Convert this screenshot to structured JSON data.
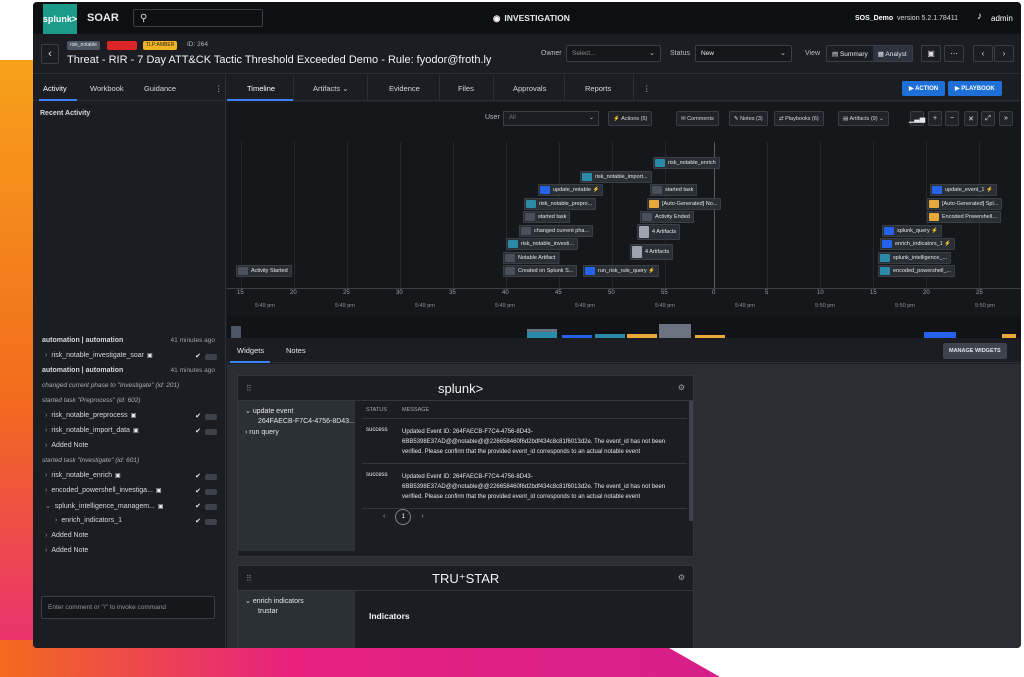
{
  "app": {
    "logo": "splunk>",
    "name": "SOAR",
    "center_title": "INVESTIGATION",
    "tenant": "SOS_Demo",
    "version": "version 5.2.1.78411",
    "user": "admin"
  },
  "case": {
    "tags": [
      "risk_notable",
      "",
      "TLP:AMBER"
    ],
    "id_label": "ID: 264",
    "title": "Threat - RIR - 7 Day ATT&CK Tactic Threshold Exceeded Demo - Rule: fyodor@froth.ly",
    "owner_label": "Owner",
    "owner_placeholder": "Select...",
    "status_label": "Status",
    "status_value": "New",
    "view_label": "View",
    "view_summary": "Summary",
    "view_analyst": "Analyst"
  },
  "left": {
    "tabs": [
      "Activity",
      "Workbook",
      "Guidance"
    ],
    "recent_title": "Recent Activity",
    "feed": [
      {
        "kind": "head",
        "text": "automation | automation",
        "time": "41 minutes ago"
      },
      {
        "kind": "item",
        "text": "risk_notable_investigate_soar"
      },
      {
        "kind": "head",
        "text": "automation | automation",
        "time": "41 minutes ago"
      },
      {
        "kind": "note",
        "text": "changed current phase to \"Investigate\" (id: 201)"
      },
      {
        "kind": "note",
        "text": "started task \"Preprocess\" (id: 602)"
      },
      {
        "kind": "item",
        "text": "risk_notable_preprocess"
      },
      {
        "kind": "item",
        "text": "risk_notable_import_data"
      },
      {
        "kind": "plain",
        "text": "Added Note"
      },
      {
        "kind": "note",
        "text": "started task \"Investigate\" (id: 601)"
      },
      {
        "kind": "item",
        "text": "risk_notable_enrich"
      },
      {
        "kind": "item",
        "text": "encoded_powershell_investiga..."
      },
      {
        "kind": "item",
        "text": "splunk_intelligence_managem..."
      },
      {
        "kind": "sub",
        "text": "enrich_indicators_1"
      },
      {
        "kind": "plain",
        "text": "Added Note"
      },
      {
        "kind": "plain",
        "text": "Added Note"
      }
    ],
    "comment_placeholder": "Enter comment or \"/\" to invoke command"
  },
  "main": {
    "tabs": [
      "Timeline",
      "Artifacts",
      "Evidence",
      "Files",
      "Approvals",
      "Reports"
    ],
    "action_btn": "ACTION",
    "playbook_btn": "PLAYBOOK",
    "user_label": "User",
    "user_value": "All",
    "filters": [
      "Actions (5)",
      "Comments",
      "Notes (3)",
      "Playbooks (6)",
      "Artifacts (9)"
    ],
    "events": [
      {
        "text": "risk_notable_enrich"
      },
      {
        "text": "risk_notable_import..."
      },
      {
        "text": "update_notable"
      },
      {
        "text": "started task"
      },
      {
        "text": "risk_notable_prepro..."
      },
      {
        "text": "[Auto-Generated] No..."
      },
      {
        "text": "started task"
      },
      {
        "text": "Activity Ended"
      },
      {
        "text": "changed current pha..."
      },
      {
        "text": "4 Artifacts"
      },
      {
        "text": "risk_notable_investi..."
      },
      {
        "text": "4 Artifacts"
      },
      {
        "text": "Notable Artifact"
      },
      {
        "text": "Created on Splunk S..."
      },
      {
        "text": "run_risk_rule_query"
      },
      {
        "text": "Activity Started"
      },
      {
        "text": "update_event_1"
      },
      {
        "text": "[Auto-Generated] Spl..."
      },
      {
        "text": "Encoded Powershell..."
      },
      {
        "text": "splunk_query"
      },
      {
        "text": "enrich_indicators_1"
      },
      {
        "text": "splunk_intelligence_..."
      },
      {
        "text": "encoded_powershell_..."
      }
    ],
    "ticks": [
      "15",
      "20",
      "25",
      "30",
      "35",
      "40",
      "45",
      "50",
      "55",
      "0",
      "5",
      "10",
      "15",
      "20",
      "25"
    ],
    "tick_times": [
      "5:49 pm",
      "5:49 pm",
      "5:49 pm",
      "5:49 pm",
      "5:49 pm",
      "5:49 pm",
      "5:49 pm",
      "5:50 pm",
      "5:50 pm",
      "5:50 pm"
    ],
    "widget_tabs": [
      "Widgets",
      "Notes"
    ],
    "manage_btn": "MANAGE WIDGETS"
  },
  "widget1": {
    "logo": "splunk>",
    "tree": [
      "update event",
      "264FAECB-F7C4-4756-8D43...",
      "run query"
    ],
    "col_status": "STATUS",
    "col_message": "MESSAGE",
    "rows": [
      {
        "status": "success",
        "message": "Updated Event ID: 264FAECB-F7C4-4756-8D43-6BB5398E37AD@@notable@@226658460f6d2bdf434c8c81f6013d2e. The event_id has not been verified. Please confirm that the provided event_id corresponds to an actual notable event"
      },
      {
        "status": "success",
        "message": "Updated Event ID: 264FAECB-F7C4-4756-8D43-6BB5398E37AD@@notable@@226658460f6d2bdf434c8c81f6013d2e. The event_id has not been verified. Please confirm that the provided event_id corresponds to an actual notable event"
      }
    ],
    "page": "1"
  },
  "widget2": {
    "logo": "TRU⁺STAR",
    "tree": [
      "enrich indicators",
      "trustar"
    ],
    "heading": "Indicators"
  }
}
